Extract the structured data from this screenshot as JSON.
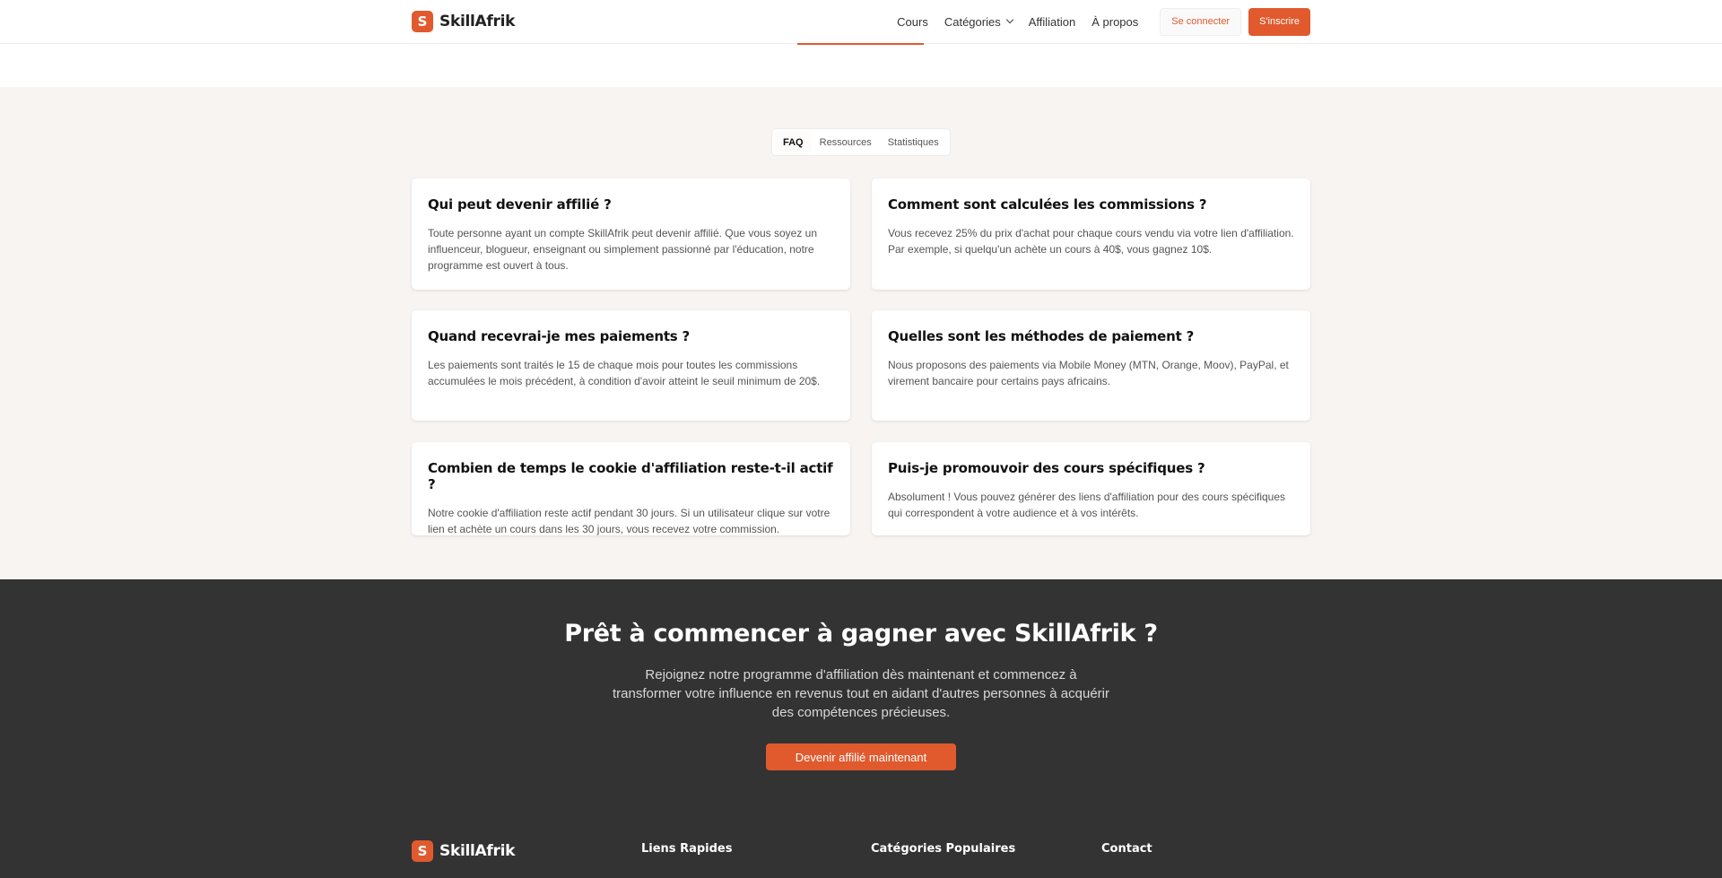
{
  "brand": {
    "logo_letter": "S",
    "name": "SkillAfrik",
    "accent_color": "#e05a2e"
  },
  "nav": {
    "links": [
      "Cours",
      "Catégories",
      "Affiliation",
      "À propos"
    ],
    "login_label": "Se connecter",
    "signup_label": "S'inscrire"
  },
  "tabs": [
    "FAQ",
    "Ressources",
    "Statistiques"
  ],
  "active_tab": "FAQ",
  "faq": [
    {
      "question": "Qui peut devenir affilié ?",
      "answer": "Toute personne ayant un compte SkillAfrik peut devenir affilié. Que vous soyez un influenceur, blogueur, enseignant ou simplement passionné par l'éducation, notre programme est ouvert à tous."
    },
    {
      "question": "Comment sont calculées les commissions ?",
      "answer": "Vous recevez 25% du prix d'achat pour chaque cours vendu via votre lien d'affiliation. Par exemple, si quelqu'un achète un cours à 40$, vous gagnez 10$."
    },
    {
      "question": "Quand recevrai-je mes paiements ?",
      "answer": "Les paiements sont traités le 15 de chaque mois pour toutes les commissions accumulées le mois précédent, à condition d'avoir atteint le seuil minimum de 20$."
    },
    {
      "question": "Quelles sont les méthodes de paiement ?",
      "answer": "Nous proposons des paiements via Mobile Money (MTN, Orange, Moov), PayPal, et virement bancaire pour certains pays africains."
    },
    {
      "question": "Combien de temps le cookie d'affiliation reste-t-il actif ?",
      "answer": "Notre cookie d'affiliation reste actif pendant 30 jours. Si un utilisateur clique sur votre lien et achète un cours dans les 30 jours, vous recevez votre commission."
    },
    {
      "question": "Puis-je promouvoir des cours spécifiques ?",
      "answer": "Absolument ! Vous pouvez générer des liens d'affiliation pour des cours spécifiques qui correspondent à votre audience et à vos intérêts."
    }
  ],
  "cta": {
    "title": "Prêt à commencer à gagner avec SkillAfrik ?",
    "text": "Rejoignez notre programme d'affiliation dès maintenant et commencez à transformer votre influence en revenus tout en aidant d'autres personnes à acquérir des compétences précieuses.",
    "button_label": "Devenir affilié maintenant"
  },
  "footer": {
    "headings": [
      "Liens Rapides",
      "Catégories Populaires",
      "Contact"
    ]
  }
}
